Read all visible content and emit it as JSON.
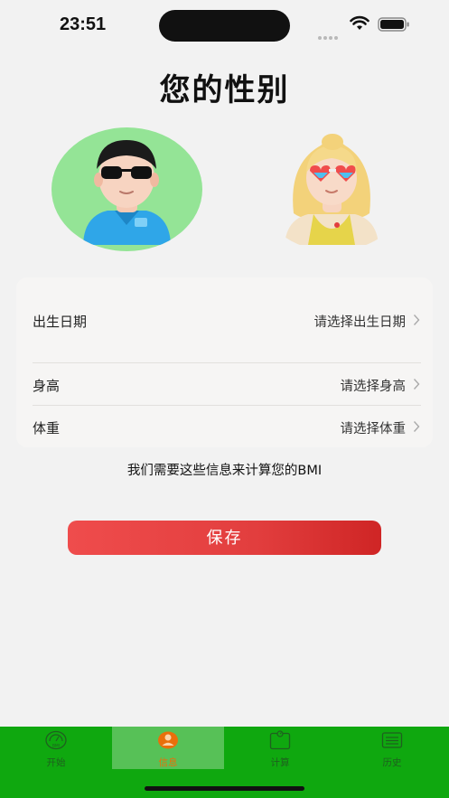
{
  "status": {
    "time": "23:51"
  },
  "title": "您的性别",
  "gender": {
    "male_icon": "male-avatar-sunglasses",
    "female_icon": "female-avatar-rainbow-glasses",
    "selected": "male",
    "selected_color": "#94e496"
  },
  "form": {
    "rows": [
      {
        "label": "出生日期",
        "value": "请选择出生日期"
      },
      {
        "label": "身高",
        "value": "请选择身高"
      },
      {
        "label": "体重",
        "value": "请选择体重"
      }
    ]
  },
  "hint": "我们需要这些信息来计算您的BMI",
  "save_label": "保存",
  "tabbar": {
    "background": "#0fa80f",
    "active_color": "#e96f0b",
    "items": [
      {
        "label": "开始",
        "icon": "bmi-gauge-icon"
      },
      {
        "label": "信息",
        "icon": "user-profile-icon",
        "active": true
      },
      {
        "label": "计算",
        "icon": "calculator-icon"
      },
      {
        "label": "历史",
        "icon": "history-list-icon"
      }
    ]
  }
}
